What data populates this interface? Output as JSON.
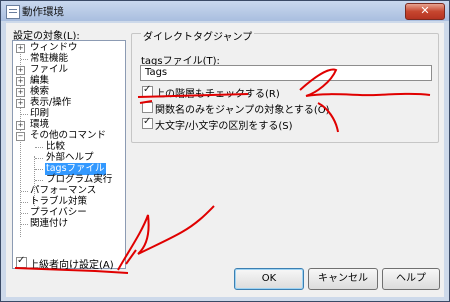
{
  "window": {
    "title": "動作環境",
    "close_label": "✕"
  },
  "left_panel": {
    "label": "設定の対象(L):"
  },
  "tree": [
    {
      "label": "ウィンドウ",
      "level": 0,
      "expandable": true
    },
    {
      "label": "常駐機能",
      "level": 0,
      "expandable": false
    },
    {
      "label": "ファイル",
      "level": 0,
      "expandable": true
    },
    {
      "label": "編集",
      "level": 0,
      "expandable": true
    },
    {
      "label": "検索",
      "level": 0,
      "expandable": true
    },
    {
      "label": "表示/操作",
      "level": 0,
      "expandable": true
    },
    {
      "label": "印刷",
      "level": 0,
      "expandable": false
    },
    {
      "label": "環境",
      "level": 0,
      "expandable": true
    },
    {
      "label": "その他のコマンド",
      "level": 0,
      "expandable": true,
      "expanded": true
    },
    {
      "label": "比較",
      "level": 1
    },
    {
      "label": "外部ヘルプ",
      "level": 1
    },
    {
      "label": "tagsファイル",
      "level": 1,
      "selected": true
    },
    {
      "label": "プログラム実行",
      "level": 1
    },
    {
      "label": "パフォーマンス",
      "level": 0
    },
    {
      "label": "トラブル対策",
      "level": 0
    },
    {
      "label": "プライバシー",
      "level": 0
    },
    {
      "label": "関連付け",
      "level": 0
    }
  ],
  "group": {
    "title": "ダイレクトタグジャンプ",
    "field_label": "tagsファイル(T):",
    "field_value": "Tags",
    "checkboxes": [
      {
        "label": "上の階層もチェックする(R)",
        "checked": true
      },
      {
        "label": "関数名のみをジャンプの対象とする(O)",
        "checked": false
      },
      {
        "label": "大文字/小文字の区別をする(S)",
        "checked": true
      }
    ]
  },
  "advanced": {
    "label": "上級者向け設定(A)",
    "checked": true
  },
  "buttons": {
    "ok": "OK",
    "cancel": "キャンセル",
    "help": "ヘルプ"
  },
  "colors": {
    "annotation": "#e00000",
    "selection": "#3399ff",
    "close": "#c6462f"
  }
}
